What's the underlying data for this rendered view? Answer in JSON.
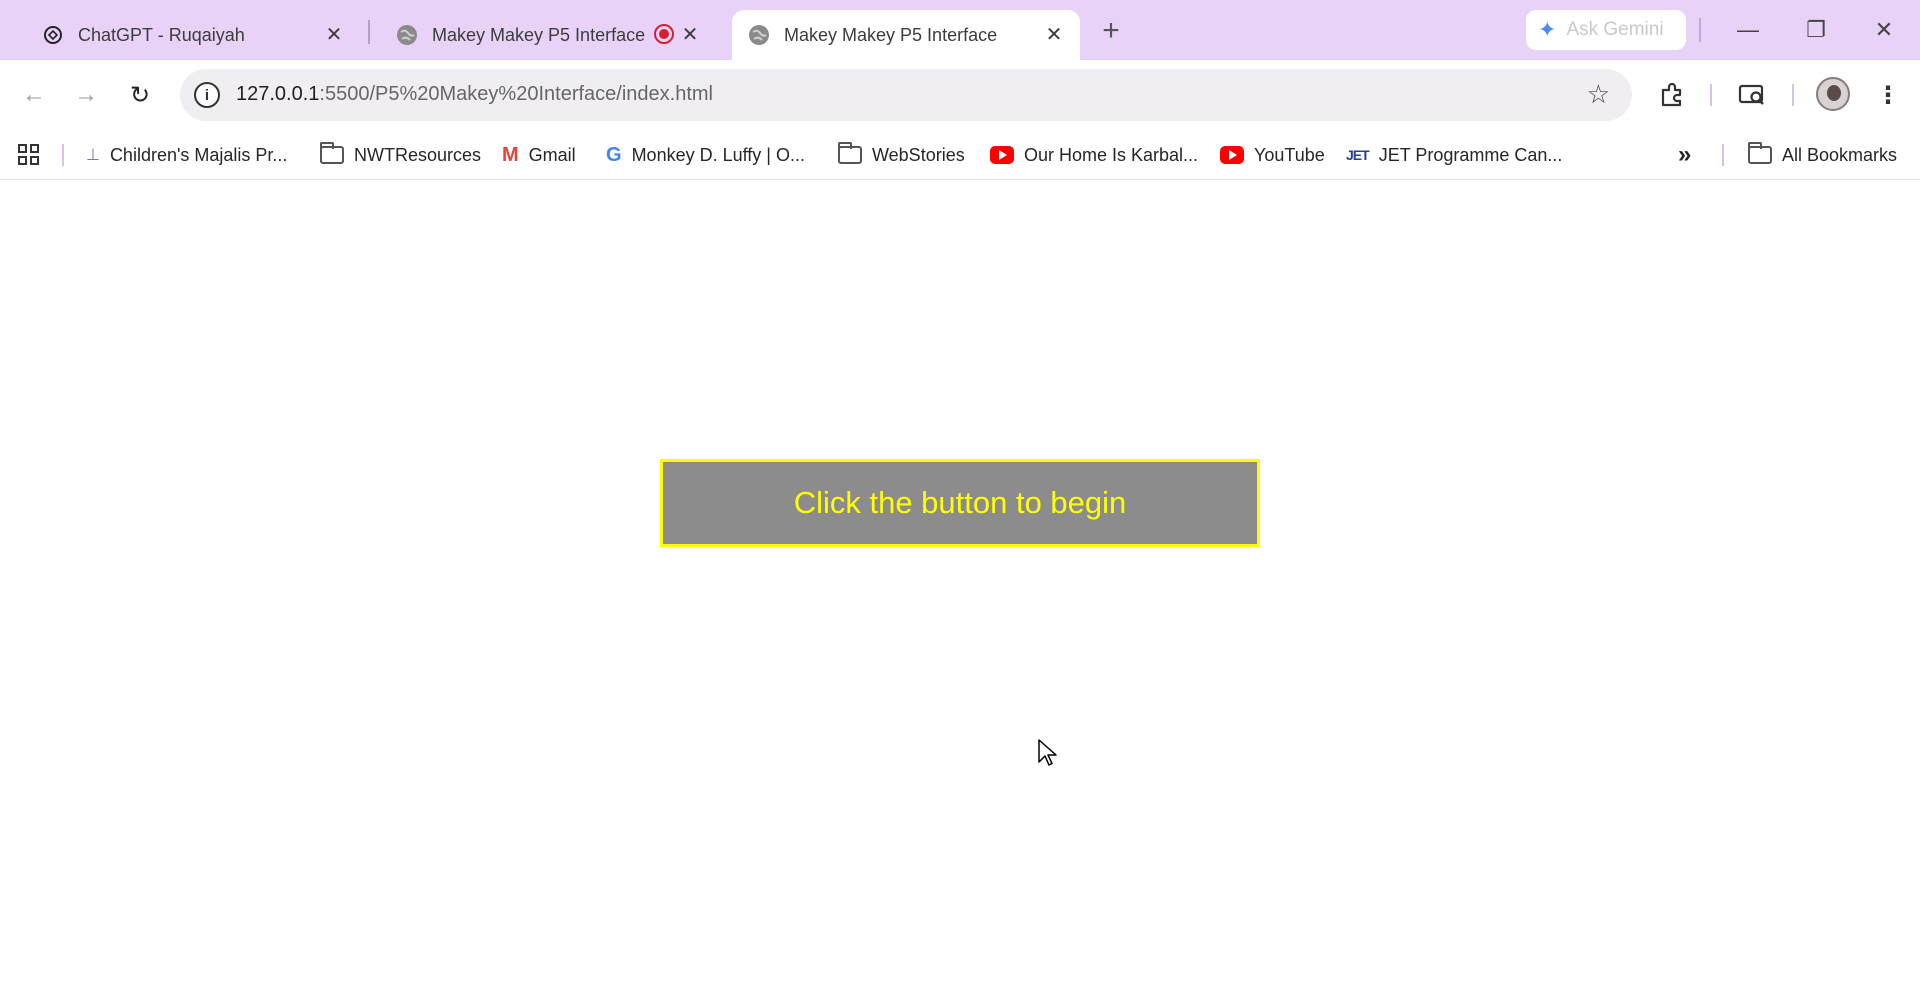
{
  "tabs": [
    {
      "title": "ChatGPT - Ruqaiyah",
      "icon": "chatgpt-icon",
      "close": "✕"
    },
    {
      "title": "Makey Makey P5 Interface",
      "icon": "globe-icon",
      "recording": true,
      "close": "✕"
    },
    {
      "title": "Makey Makey P5 Interface",
      "icon": "globe-icon",
      "active": true,
      "close": "✕"
    }
  ],
  "new_tab_label": "+",
  "gemini": {
    "label": "Ask Gemini",
    "icon": "gemini-sparkle-icon"
  },
  "window_controls": {
    "minimize": "—",
    "restore": "❐",
    "close": "✕"
  },
  "address": {
    "host": "127.0.0.1",
    "path": ":5500/P5%20Makey%20Interface/index.html"
  },
  "nav": {
    "back": "←",
    "forward": "→",
    "reload": "↻"
  },
  "bookmarks": [
    {
      "label": "Children's Majalis Pr...",
      "icon": "children-majalis-icon"
    },
    {
      "label": "NWTResources",
      "icon": "folder-icon"
    },
    {
      "label": "Gmail",
      "icon": "gmail-icon"
    },
    {
      "label": "Monkey D. Luffy | O...",
      "icon": "google-icon"
    },
    {
      "label": "WebStories",
      "icon": "folder-icon"
    },
    {
      "label": "Our Home Is Karbal...",
      "icon": "youtube-icon"
    },
    {
      "label": "YouTube",
      "icon": "youtube-icon"
    },
    {
      "label": "JET Programme Can...",
      "icon": "jet-icon"
    }
  ],
  "bookmarks_overflow": "»",
  "all_bookmarks": "All Bookmarks",
  "page": {
    "begin_button": "Click the button to begin"
  },
  "colors": {
    "tabbar": "#e8d2f7",
    "button_bg": "#8c8c8c",
    "button_text": "#ffff00"
  }
}
